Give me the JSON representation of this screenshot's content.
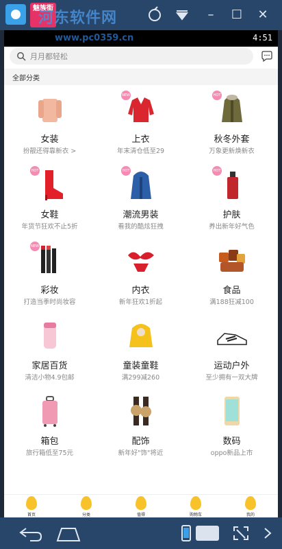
{
  "window": {
    "badge_label": "魅族街",
    "watermark": "河东软件网",
    "watermark_url": "www.pc0359.cn",
    "minimize": "–",
    "maximize": "☐",
    "close": "✕"
  },
  "status": {
    "time": "4:51"
  },
  "search": {
    "placeholder": "月月都轻松"
  },
  "section": {
    "title": "全部分类"
  },
  "categories": [
    {
      "name": "女装",
      "desc": "扮靓还得靠新衣 >",
      "icon": "coat-icon",
      "badge": ""
    },
    {
      "name": "上衣",
      "desc": "年末清仓低至29",
      "icon": "sweater-icon",
      "badge": "NEW"
    },
    {
      "name": "秋冬外套",
      "desc": "万象更新焕新衣",
      "icon": "jacket-icon",
      "badge": "HOT"
    },
    {
      "name": "女鞋",
      "desc": "年货节狂欢不止5折",
      "icon": "boot-icon",
      "badge": "HOT"
    },
    {
      "name": "潮流男装",
      "desc": "看我的酷炫狂拽",
      "icon": "parka-icon",
      "badge": "HOT"
    },
    {
      "name": "护肤",
      "desc": "养出新年好气色",
      "icon": "bottle-icon",
      "badge": "HOT"
    },
    {
      "name": "彩妆",
      "desc": "打造当季时尚妆容",
      "icon": "lipstick-icon",
      "badge": "NEW"
    },
    {
      "name": "内衣",
      "desc": "新年狂欢1折起",
      "icon": "lingerie-icon",
      "badge": ""
    },
    {
      "name": "食品",
      "desc": "满188狂减100",
      "icon": "snacks-icon",
      "badge": ""
    },
    {
      "name": "家居百货",
      "desc": "清洁小物4.9包邮",
      "icon": "cup-icon",
      "badge": ""
    },
    {
      "name": "童装童鞋",
      "desc": "满299减260",
      "icon": "kids-jacket-icon",
      "badge": ""
    },
    {
      "name": "运动户外",
      "desc": "至少拥有一双大牌",
      "icon": "sneaker-icon",
      "badge": ""
    },
    {
      "name": "箱包",
      "desc": "旅行箱低至75元",
      "icon": "suitcase-icon",
      "badge": ""
    },
    {
      "name": "配饰",
      "desc": "新年好\"饰\"将近",
      "icon": "watch-icon",
      "badge": ""
    },
    {
      "name": "数码",
      "desc": "oppo新品上市",
      "icon": "phone-icon",
      "badge": ""
    }
  ],
  "tabs": [
    {
      "label": "首页"
    },
    {
      "label": "分类"
    },
    {
      "label": "值得"
    },
    {
      "label": "购物车"
    },
    {
      "label": "我的"
    }
  ],
  "colors": {
    "accent": "#f8c22a",
    "badge": "#f58ab2",
    "chrome": "#27466a"
  }
}
